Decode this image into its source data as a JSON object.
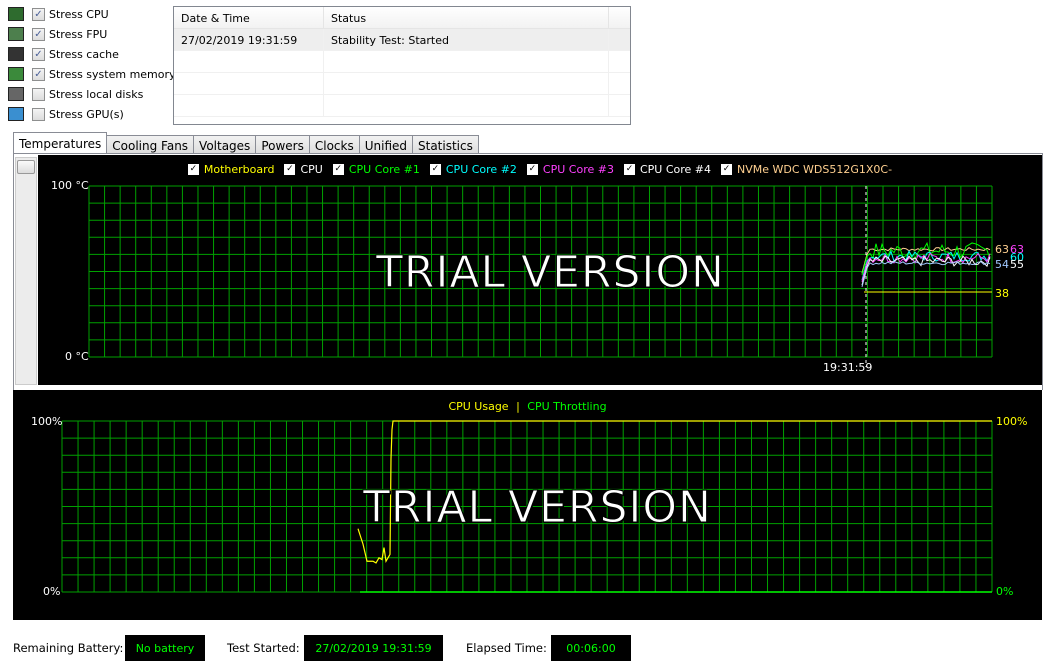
{
  "stress_options": [
    {
      "label": "Stress CPU",
      "checked": true,
      "icon": "cpu-icon"
    },
    {
      "label": "Stress FPU",
      "checked": true,
      "icon": "fpu-icon"
    },
    {
      "label": "Stress cache",
      "checked": true,
      "icon": "cache-icon"
    },
    {
      "label": "Stress system memory",
      "checked": true,
      "icon": "memory-icon"
    },
    {
      "label": "Stress local disks",
      "checked": false,
      "icon": "disk-icon"
    },
    {
      "label": "Stress GPU(s)",
      "checked": false,
      "icon": "gpu-icon"
    }
  ],
  "log": {
    "columns": [
      "Date & Time",
      "Status"
    ],
    "rows": [
      [
        "27/02/2019 19:31:59",
        "Stability Test: Started"
      ]
    ]
  },
  "tabs": [
    "Temperatures",
    "Cooling Fans",
    "Voltages",
    "Powers",
    "Clocks",
    "Unified",
    "Statistics"
  ],
  "active_tab": "Temperatures",
  "temp_chart": {
    "legend": [
      {
        "label": "Motherboard",
        "color": "#ffff00"
      },
      {
        "label": "CPU",
        "color": "#ffffff"
      },
      {
        "label": "CPU Core #1",
        "color": "#00ff00"
      },
      {
        "label": "CPU Core #2",
        "color": "#00ffff"
      },
      {
        "label": "CPU Core #3",
        "color": "#ff40ff"
      },
      {
        "label": "CPU Core #4",
        "color": "#ffffff"
      },
      {
        "label": "NVMe WDC WDS512G1X0C-",
        "color": "#ffd090"
      }
    ],
    "y_max_label": "100 °C",
    "y_min_label": "0 °C",
    "time_label": "19:31:59",
    "watermark": "TRIAL VERSION",
    "readouts": [
      {
        "value": "63",
        "color": "#ffd090"
      },
      {
        "value": "63",
        "color": "#ff40ff"
      },
      {
        "value": "60",
        "color": "#00ffff"
      },
      {
        "value": "54",
        "color": "#a0c8ff"
      },
      {
        "value": "55",
        "color": "#ffffff"
      },
      {
        "value": "38",
        "color": "#ffff00"
      }
    ],
    "grid_color": "#00a000"
  },
  "cpu_chart": {
    "legend_usage": "CPU Usage",
    "legend_sep": "|",
    "legend_throttling": "CPU Throttling",
    "usage_color": "#ffff00",
    "throttling_color": "#00ff00",
    "y_max_label": "100%",
    "y_min_label": "0%",
    "right_max_label": "100%",
    "right_min_label": "0%",
    "watermark": "TRIAL VERSION"
  },
  "status": {
    "battery_label": "Remaining Battery:",
    "battery_value": "No battery",
    "started_label": "Test Started:",
    "started_value": "27/02/2019 19:31:59",
    "elapsed_label": "Elapsed Time:",
    "elapsed_value": "00:06:00"
  }
}
